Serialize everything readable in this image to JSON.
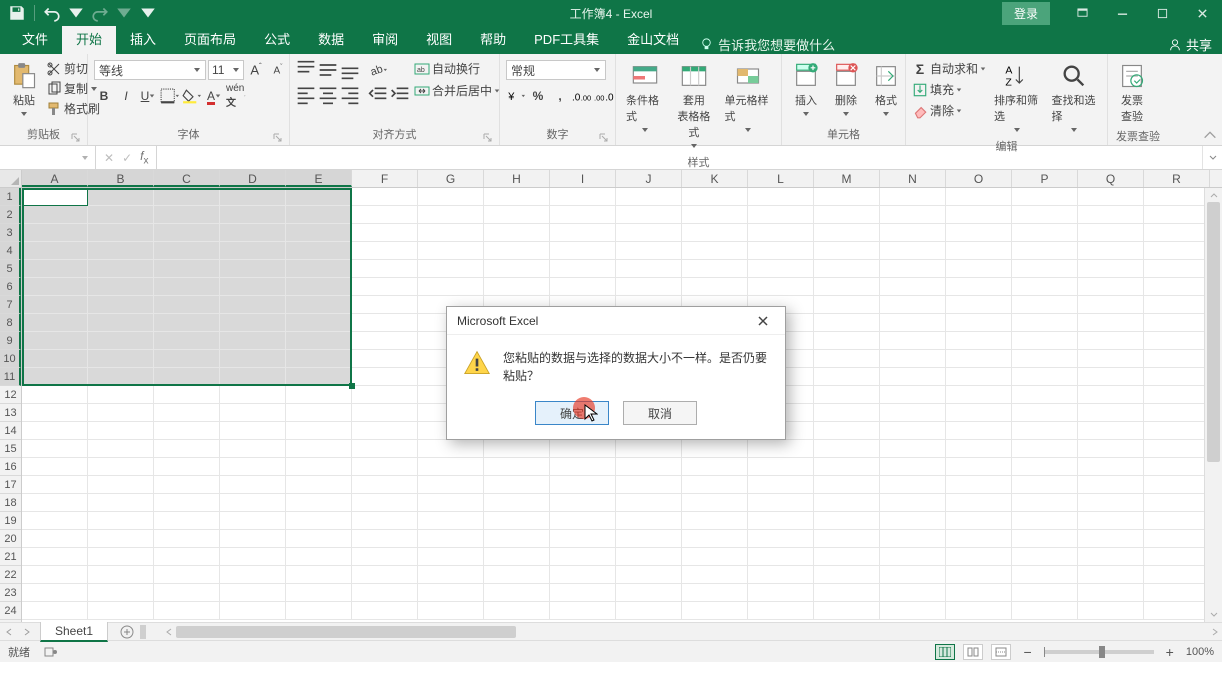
{
  "title": "工作簿4  -  Excel",
  "qat": {
    "save": "save",
    "undo": "undo",
    "redo": "redo"
  },
  "login_label": "登录",
  "tabs": {
    "file": "文件",
    "home": "开始",
    "insert": "插入",
    "page": "页面布局",
    "formulas": "公式",
    "data": "数据",
    "review": "审阅",
    "view": "视图",
    "help": "帮助",
    "pdf": "PDF工具集",
    "wps": "金山文档"
  },
  "tellme": "告诉我您想要做什么",
  "share": "共享",
  "ribbon": {
    "clipboard": {
      "paste": "粘贴",
      "cut": "剪切",
      "copy": "复制",
      "painter": "格式刷",
      "group": "剪贴板"
    },
    "font": {
      "name": "等线",
      "size": "11",
      "group": "字体"
    },
    "align": {
      "wrap": "自动换行",
      "merge": "合并后居中",
      "group": "对齐方式"
    },
    "number": {
      "format": "常规",
      "group": "数字"
    },
    "styles": {
      "cond": "条件格式",
      "table": "套用\n表格格式",
      "cell": "单元格样式",
      "group": "样式"
    },
    "cells": {
      "insert": "插入",
      "delete": "删除",
      "format": "格式",
      "group": "单元格"
    },
    "editing": {
      "sum": "自动求和",
      "fill": "填充",
      "clear": "清除",
      "sort": "排序和筛选",
      "find": "查找和选择",
      "group": "编辑"
    },
    "invoice": {
      "btn": "发票\n查验",
      "group": "发票查验"
    }
  },
  "namebox": "",
  "columns": [
    "A",
    "B",
    "C",
    "D",
    "E",
    "F",
    "G",
    "H",
    "I",
    "J",
    "K",
    "L",
    "M",
    "N",
    "O",
    "P",
    "Q",
    "R"
  ],
  "rows": [
    "1",
    "2",
    "3",
    "4",
    "5",
    "6",
    "7",
    "8",
    "9",
    "10",
    "11",
    "12",
    "13",
    "14",
    "15",
    "16",
    "17",
    "18",
    "19",
    "20",
    "21",
    "22",
    "23",
    "24"
  ],
  "sheet_tab": "Sheet1",
  "status": {
    "ready": "就绪",
    "recording_off": "",
    "zoom": "100%"
  },
  "dialog": {
    "title": "Microsoft Excel",
    "message": "您粘贴的数据与选择的数据大小不一样。是否仍要粘贴？",
    "ok": "确定",
    "cancel": "取消"
  }
}
